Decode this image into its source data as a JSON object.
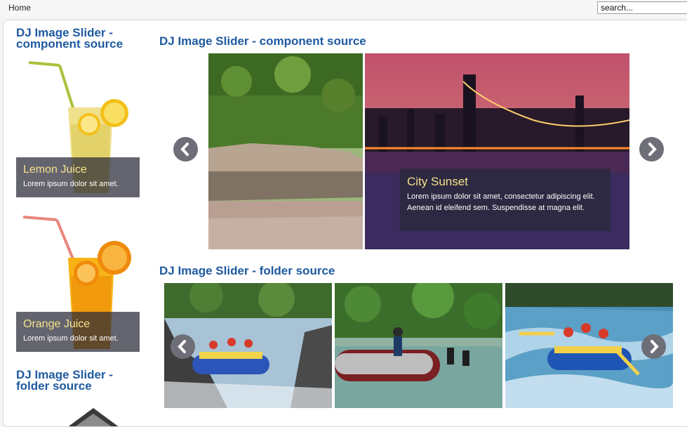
{
  "topbar": {
    "home": "Home",
    "search_placeholder": "search..."
  },
  "sidebar": {
    "heading1": "DJ Image Slider -\ncomponent source",
    "heading2": "DJ Image Slider -\nfolder source",
    "slides": [
      {
        "title": "Lemon Juice",
        "desc": "Lorem ipsum dolor sit amet."
      },
      {
        "title": "Orange Juice",
        "desc": "Lorem ipsum dolor sit amet."
      }
    ]
  },
  "main": {
    "heading1": "DJ Image Slider - component source",
    "heading2": "DJ Image Slider - folder source",
    "slide": {
      "title": "City Sunset",
      "desc": "Lorem ipsum dolor sit amet, consectetur adipiscing elit. Aenean id eleifend sem. Suspendisse at magna elit."
    }
  },
  "icons": {
    "prev": "chevron-left-icon",
    "next": "chevron-right-icon"
  },
  "colors": {
    "heading": "#1e5aa0",
    "caption_title": "#f6e28a",
    "arrow_bg": "#6e6e78"
  }
}
